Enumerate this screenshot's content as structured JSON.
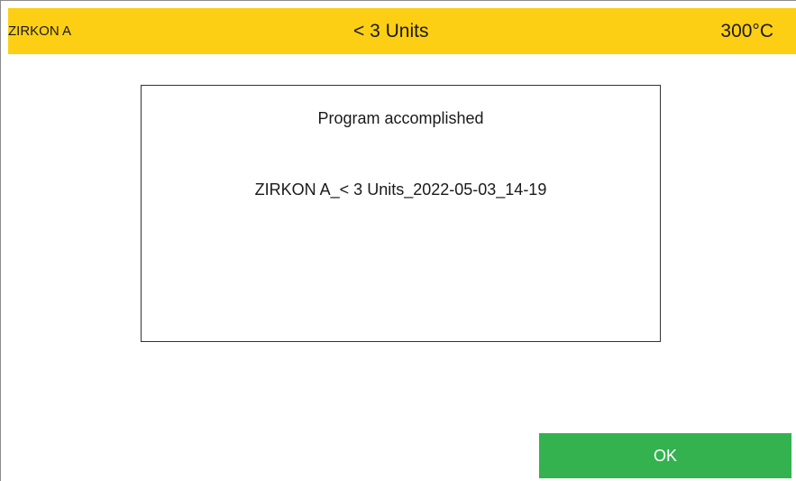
{
  "header": {
    "material": "ZIRKON A",
    "program": "< 3 Units",
    "temperature": "300°C"
  },
  "dialog": {
    "title": "Program accomplished",
    "program_name": "ZIRKON A_< 3 Units_2022-05-03_14-19"
  },
  "actions": {
    "ok_label": "OK"
  },
  "colors": {
    "header_background": "#fccf14",
    "ok_button_background": "#33b24f"
  }
}
